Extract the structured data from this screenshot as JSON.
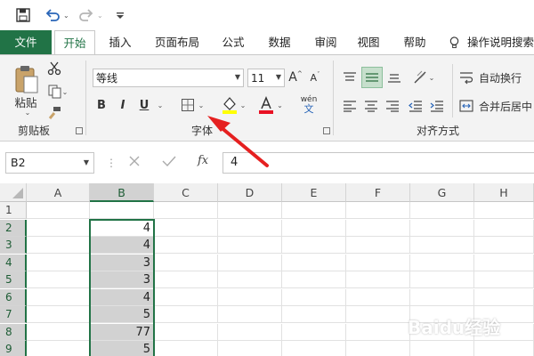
{
  "quick_access": {
    "icons": [
      "save-icon",
      "undo-icon",
      "redo-icon",
      "customize-icon"
    ]
  },
  "tabs": [
    "文件",
    "开始",
    "插入",
    "页面布局",
    "公式",
    "数据",
    "审阅",
    "视图",
    "帮助"
  ],
  "tell_me": "操作说明搜索",
  "ribbon": {
    "clipboard": {
      "paste_label": "粘贴",
      "group_label": "剪贴板"
    },
    "font": {
      "font_name": "等线",
      "font_size": "11",
      "bold": "B",
      "italic": "I",
      "underline": "U",
      "group_label": "字体",
      "grow": "A",
      "shrink": "A",
      "phonetic_top": "wén",
      "phonetic_bottom": "文"
    },
    "alignment": {
      "wrap_text": "自动换行",
      "merge_center": "合并后居中",
      "group_label": "对齐方式"
    }
  },
  "formula_bar": {
    "name_box": "B2",
    "fx": "fx",
    "value": "4"
  },
  "grid": {
    "columns": [
      "A",
      "B",
      "C",
      "D",
      "E",
      "F",
      "G",
      "H"
    ],
    "rows": [
      "1",
      "2",
      "3",
      "4",
      "5",
      "6",
      "7",
      "8",
      "9"
    ],
    "column_b_values": [
      "",
      "4",
      "4",
      "3",
      "3",
      "4",
      "5",
      "77",
      "5"
    ]
  },
  "colors": {
    "accent": "#217346",
    "selection_fill": "#d2d2d2",
    "annotation_arrow": "#e52020"
  },
  "watermark": "Baidu经验"
}
